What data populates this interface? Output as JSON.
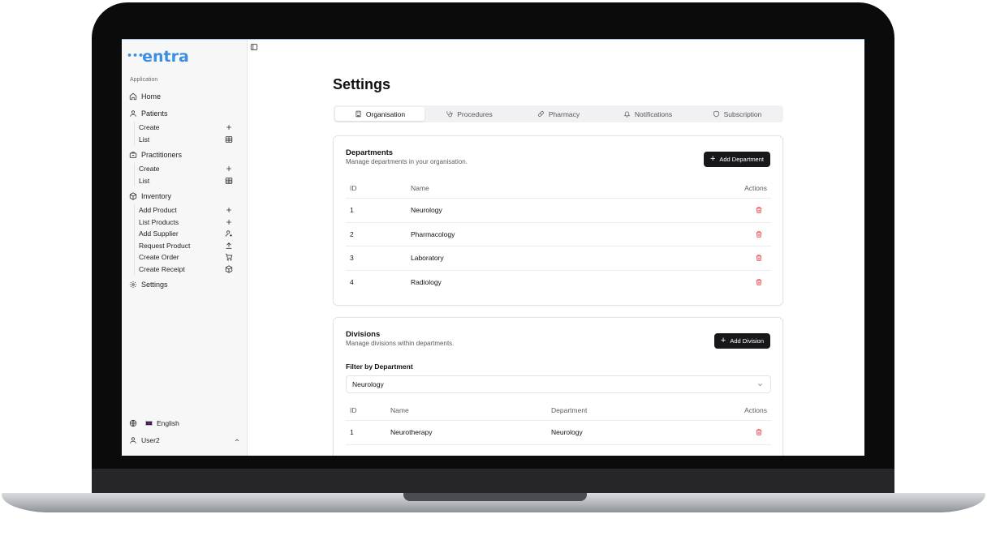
{
  "app": {
    "logo_text": "ntra",
    "logo_dots": "•••"
  },
  "sidebar": {
    "section_label": "Application",
    "home": "Home",
    "patients": {
      "label": "Patients",
      "items": [
        {
          "label": "Create",
          "icon": "plus-icon"
        },
        {
          "label": "List",
          "icon": "table-icon"
        }
      ]
    },
    "practitioners": {
      "label": "Practitioners",
      "items": [
        {
          "label": "Create",
          "icon": "plus-icon"
        },
        {
          "label": "List",
          "icon": "table-icon"
        }
      ]
    },
    "inventory": {
      "label": "Inventory",
      "items": [
        {
          "label": "Add Product",
          "icon": "plus-icon"
        },
        {
          "label": "List Products",
          "icon": "plus-icon"
        },
        {
          "label": "Add Supplier",
          "icon": "user-plus-icon"
        },
        {
          "label": "Request Product",
          "icon": "upload-icon"
        },
        {
          "label": "Create Order",
          "icon": "cart-icon"
        },
        {
          "label": "Create Receipt",
          "icon": "package-icon"
        }
      ]
    },
    "settings": "Settings",
    "language": "English",
    "user": "User2"
  },
  "page": {
    "title": "Settings",
    "tabs": [
      {
        "label": "Organisation",
        "icon": "building-icon",
        "active": true
      },
      {
        "label": "Procedures",
        "icon": "stethoscope-icon",
        "active": false
      },
      {
        "label": "Pharmacy",
        "icon": "pill-icon",
        "active": false
      },
      {
        "label": "Notifications",
        "icon": "bell-icon",
        "active": false
      },
      {
        "label": "Subscription",
        "icon": "shield-icon",
        "active": false
      }
    ]
  },
  "departments": {
    "title": "Departments",
    "description": "Manage departments in your organisation.",
    "add_button": "Add Department",
    "columns": [
      "ID",
      "Name",
      "Actions"
    ],
    "rows": [
      {
        "id": "1",
        "name": "Neurology"
      },
      {
        "id": "2",
        "name": "Pharmacology"
      },
      {
        "id": "3",
        "name": "Laboratory"
      },
      {
        "id": "4",
        "name": "Radiology"
      }
    ]
  },
  "divisions": {
    "title": "Divisions",
    "description": "Manage divisions within departments.",
    "add_button": "Add Division",
    "filter_label": "Filter by Department",
    "filter_value": "Neurology",
    "columns": [
      "ID",
      "Name",
      "Department",
      "Actions"
    ],
    "rows": [
      {
        "id": "1",
        "name": "Neurotherapy",
        "department": "Neurology"
      }
    ]
  },
  "colors": {
    "brand": "#3b8ee0",
    "danger": "#e5484d",
    "button_dark": "#18181b"
  }
}
